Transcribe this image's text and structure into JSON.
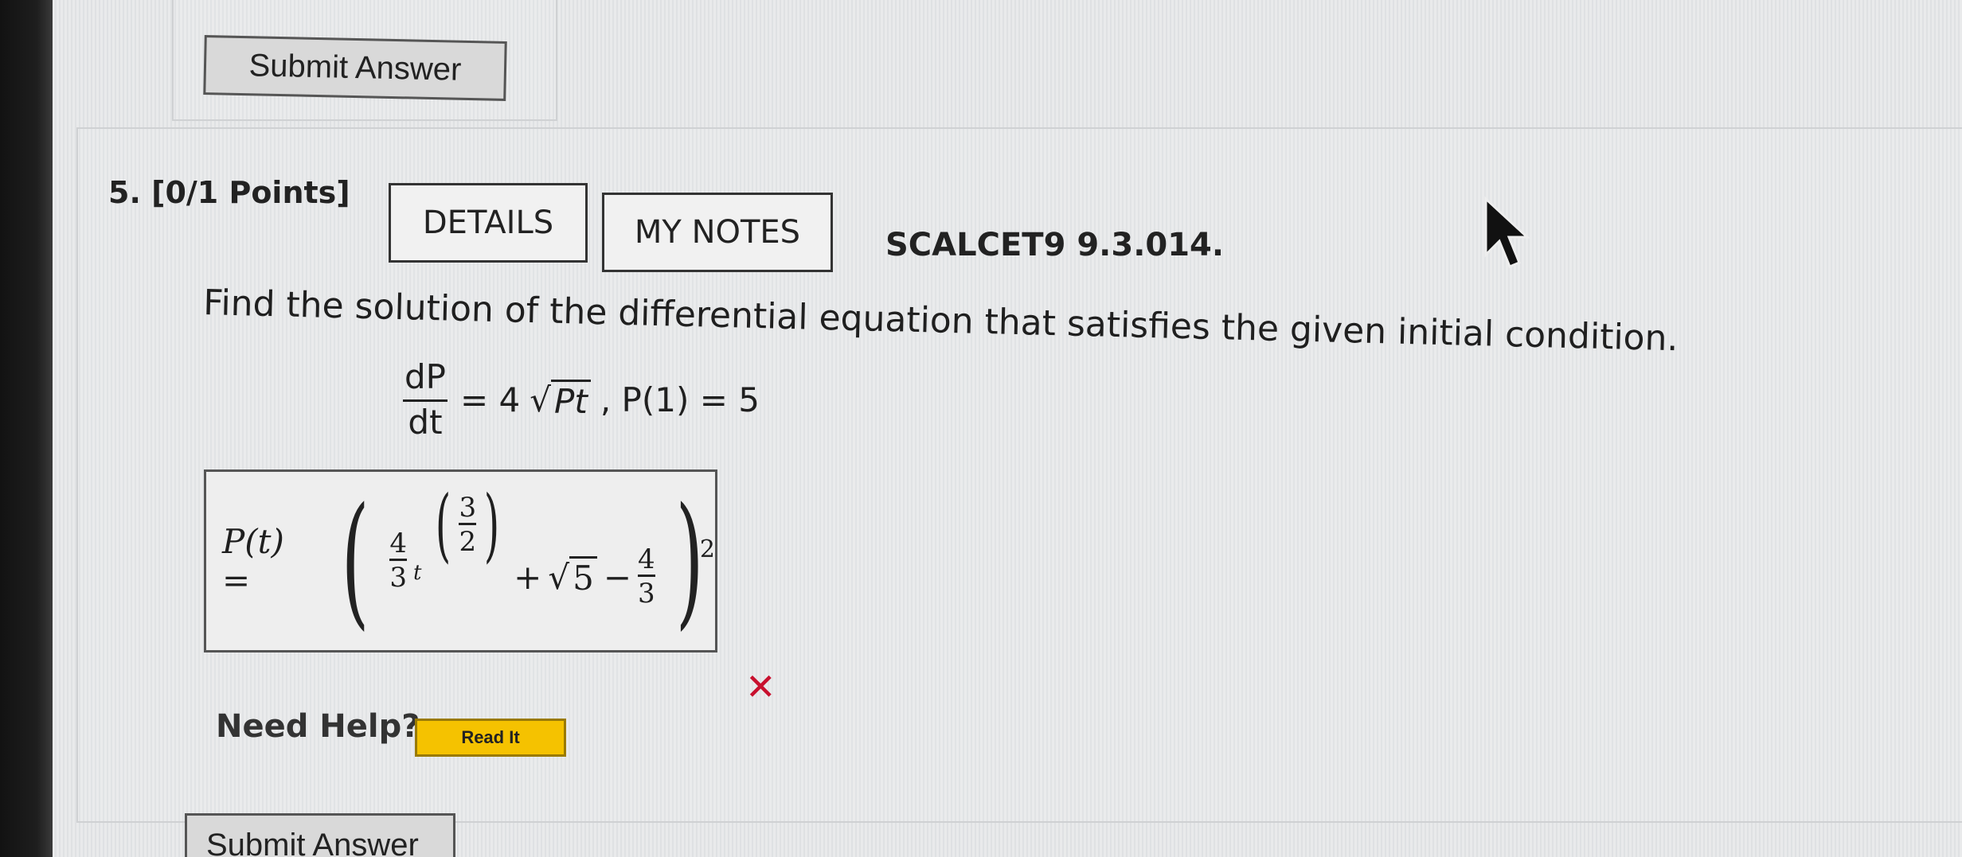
{
  "submit_top": {
    "label": "Submit Answer"
  },
  "question": {
    "number_points": "5. [0/1 Points]",
    "tabs": [
      {
        "label": "DETAILS"
      },
      {
        "label": "MY NOTES"
      }
    ],
    "source": "SCALCET9 9.3.014.",
    "prompt": "Find the solution of the differential equation that satisfies the given initial condition.",
    "equation": {
      "frac_num": "dP",
      "frac_den": "dt",
      "equals": "= 4",
      "radicand": "Pt",
      "initial": ", P(1) = 5"
    }
  },
  "answer": {
    "lhs": "P(t) =",
    "coef_num": "4",
    "coef_den": "3",
    "var": "t",
    "exp_num": "3",
    "exp_den": "2",
    "plus": "+",
    "sqrt_num": "5",
    "minus": "−",
    "sub_num": "4",
    "sub_den": "3",
    "outer_exp": "2",
    "status": "✕"
  },
  "help": {
    "label": "Need Help?",
    "read_it": "Read It"
  },
  "submit_bottom": {
    "label": "Submit Answer"
  },
  "colors": {
    "wrong": "#c8102e",
    "read_it_bg": "#f5c200"
  },
  "icons": {
    "cursor": "mouse-pointer-icon",
    "wrong": "x-mark-icon"
  }
}
